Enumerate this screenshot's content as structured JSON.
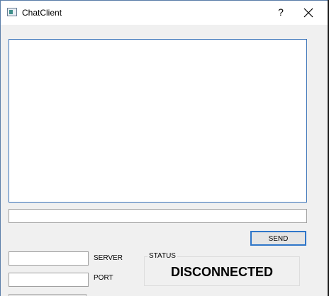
{
  "window": {
    "title": "ChatClient",
    "help_label": "?",
    "close_icon": "close-icon",
    "app_icon": "window-app-icon"
  },
  "chat": {
    "message_input_value": ""
  },
  "actions": {
    "send_label": "SEND"
  },
  "connection": {
    "server_value": "",
    "server_label": "SERVER",
    "port_value": "",
    "port_label": "PORT"
  },
  "status": {
    "title": "STATUS",
    "value": "DISCONNECTED"
  },
  "colors": {
    "focus_border": "#2f76c9",
    "background": "#f0f0f0"
  }
}
